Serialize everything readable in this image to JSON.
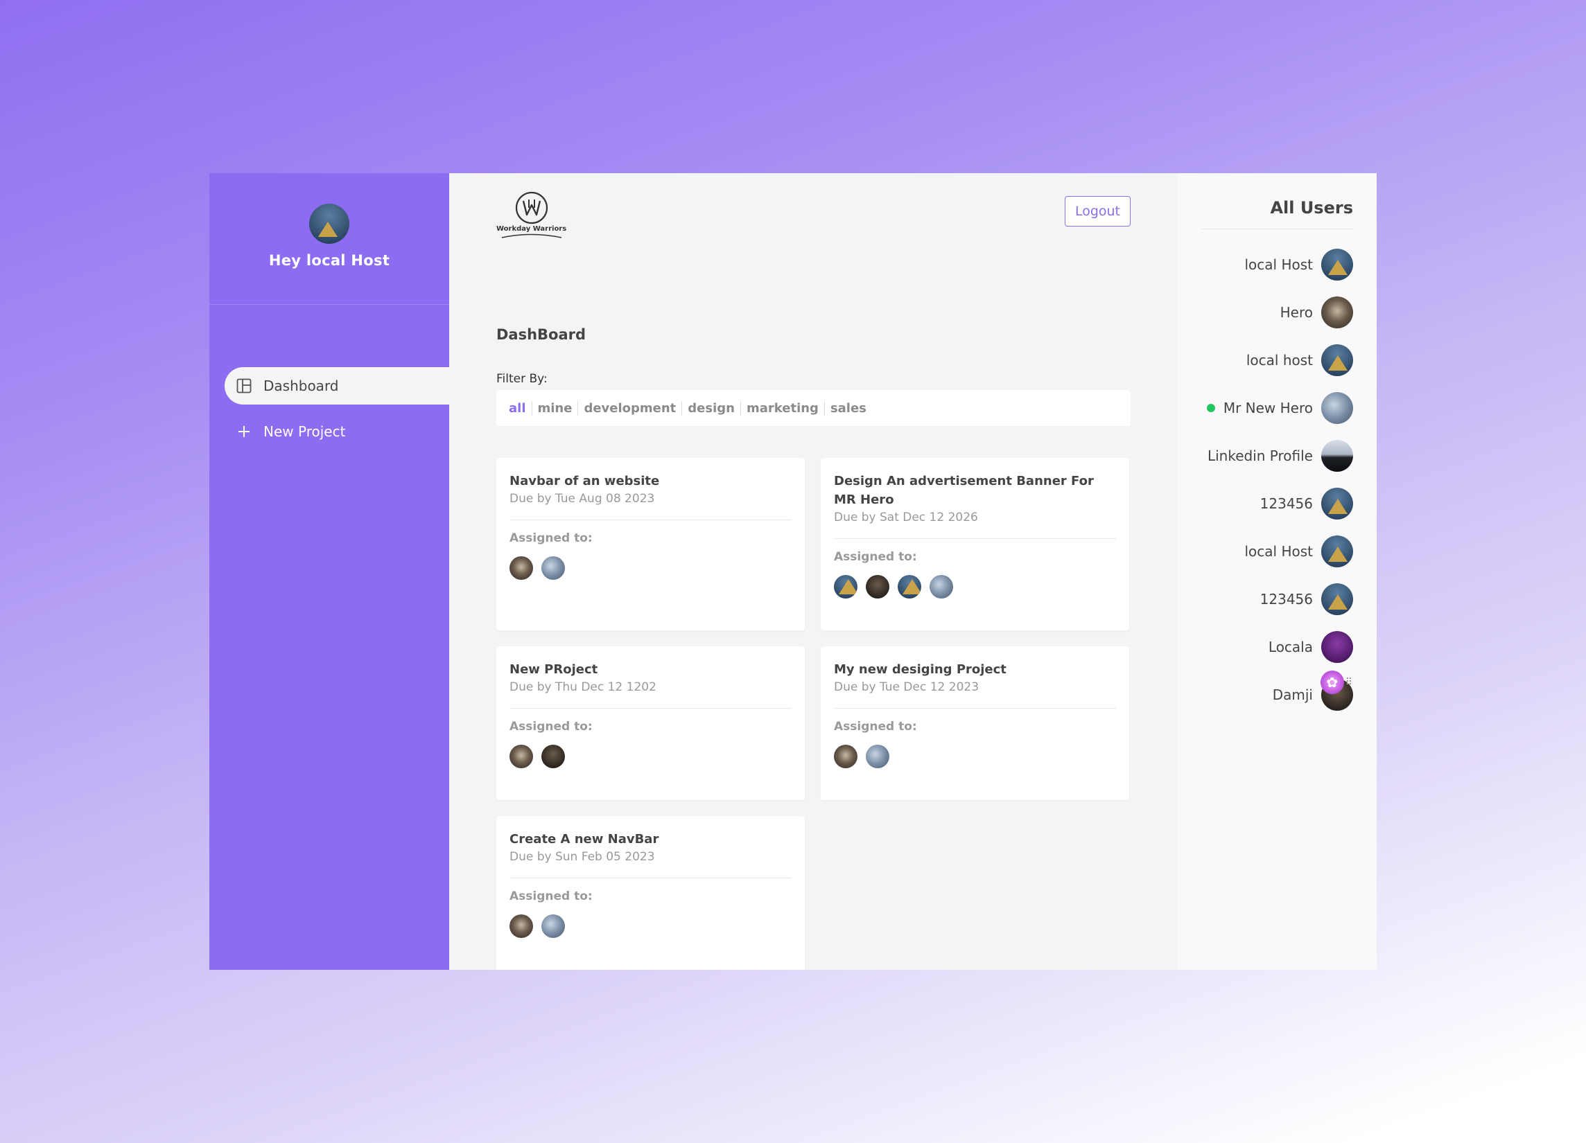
{
  "sidebar": {
    "greeting": "Hey local Host",
    "nav": [
      {
        "label": "Dashboard",
        "icon": "dashboard-icon",
        "active": true
      },
      {
        "label": "New Project",
        "icon": "plus-icon",
        "active": false
      }
    ]
  },
  "header": {
    "logo_text": "Workday Warriors",
    "logout_label": "Logout"
  },
  "main": {
    "title": "DashBoard",
    "filter_label": "Filter By:",
    "filters": [
      "all",
      "mine",
      "development",
      "design",
      "marketing",
      "sales"
    ],
    "active_filter": "all"
  },
  "projects": [
    {
      "title": "Navbar of an website",
      "due": "Due by Tue Aug 08 2023",
      "assigned_label": "Assigned to:",
      "assignees": [
        "hero",
        "space"
      ]
    },
    {
      "title": "Design An advertisement Banner For MR Hero",
      "due": "Due by Sat Dec 12 2026",
      "assigned_label": "Assigned to:",
      "assignees": [
        "pyramid",
        "dark",
        "pyramid",
        "space"
      ]
    },
    {
      "title": "New PRoject",
      "due": "Due by Thu Dec 12 1202",
      "assigned_label": "Assigned to:",
      "assignees": [
        "hero",
        "dark"
      ]
    },
    {
      "title": "My new desiging Project",
      "due": "Due by Tue Dec 12 2023",
      "assigned_label": "Assigned to:",
      "assignees": [
        "hero",
        "space"
      ]
    },
    {
      "title": "Create A new NavBar",
      "due": "Due by Sun Feb 05 2023",
      "assigned_label": "Assigned to:",
      "assignees": [
        "hero",
        "space"
      ]
    }
  ],
  "users_panel": {
    "heading": "All Users",
    "users": [
      {
        "name": "local Host",
        "avatar": "pyramid",
        "online": false
      },
      {
        "name": "Hero",
        "avatar": "hero",
        "online": false
      },
      {
        "name": "local host",
        "avatar": "pyramid",
        "online": false
      },
      {
        "name": "Mr New Hero",
        "avatar": "space",
        "online": true
      },
      {
        "name": "Linkedin Profile",
        "avatar": "city",
        "online": false
      },
      {
        "name": "123456",
        "avatar": "pyramid",
        "online": false
      },
      {
        "name": "local Host",
        "avatar": "pyramid",
        "online": false
      },
      {
        "name": "123456",
        "avatar": "pyramid",
        "online": false
      },
      {
        "name": "Locala",
        "avatar": "purple",
        "online": false
      },
      {
        "name": "Damji",
        "avatar": "dark",
        "online": false
      }
    ]
  },
  "colors": {
    "accent": "#8c6cf0",
    "online": "#22c55e"
  }
}
